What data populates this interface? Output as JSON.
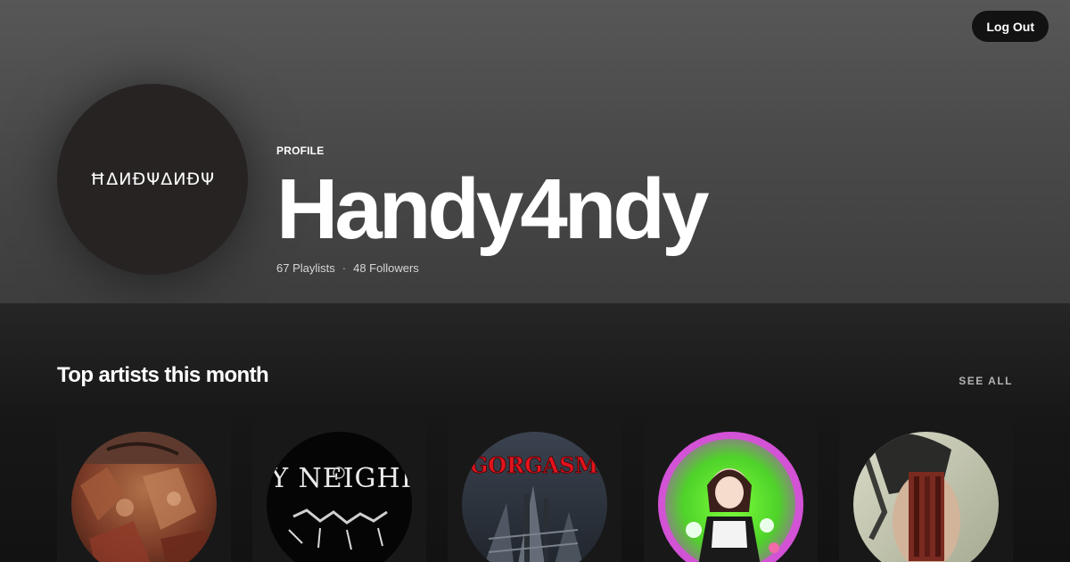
{
  "header": {
    "logout_label": "Log Out",
    "avatar_text": "ĦΔИÐΨΔИÐΨ",
    "profile_label": "PROFILE",
    "display_name": "Handy4ndy",
    "playlists": "67 Playlists",
    "separator": "·",
    "followers": "48 Followers"
  },
  "top_artists": {
    "title": "Top artists this month",
    "see_all_label": "SEE ALL",
    "artists": [
      {
        "art": "gore-painting",
        "logo": ""
      },
      {
        "art": "black-white-logo",
        "logo": "NOISY NEIGHBORS"
      },
      {
        "art": "red-logo-staircase",
        "logo": "GORGASM"
      },
      {
        "art": "neon-anime-art",
        "logo": ""
      },
      {
        "art": "face-portrait-art",
        "logo": ""
      }
    ]
  },
  "colors": {
    "header_top": "#575757",
    "header_bottom": "#3d3d3d",
    "background": "#121212",
    "card": "#181818",
    "avatar_bg": "#282323",
    "muted_text": "#b3b3b3"
  }
}
